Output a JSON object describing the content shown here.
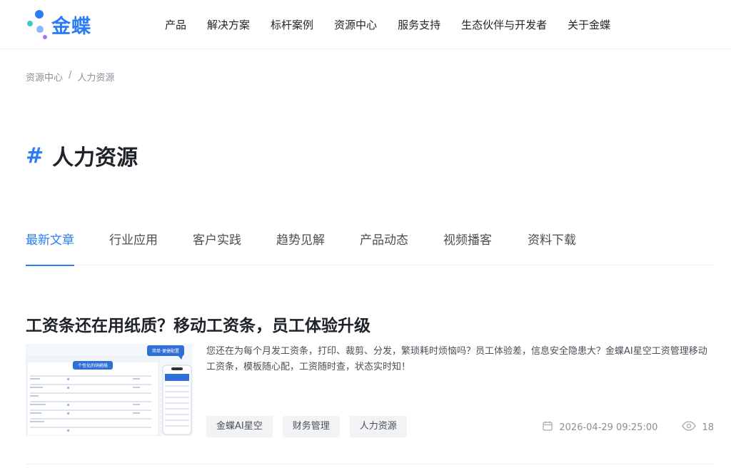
{
  "brand": {
    "name": "金蝶",
    "colors": {
      "primary": "#2a7df5",
      "dot_teal": "#3fc8c2",
      "dot_purple": "#a974f0",
      "dot_blue": "#2a7df5"
    }
  },
  "nav": {
    "items": [
      "产品",
      "解决方案",
      "标杆案例",
      "资源中心",
      "服务支持",
      "生态伙伴与开发者",
      "关于金蝶"
    ]
  },
  "breadcrumb": {
    "items": [
      "资源中心",
      "人力资源"
    ],
    "separator": "/"
  },
  "page": {
    "hash": "#",
    "title": "人力资源"
  },
  "tabs": {
    "items": [
      "最新文章",
      "行业应用",
      "客户实践",
      "趋势见解",
      "产品动态",
      "视频播客",
      "资料下载"
    ],
    "active_index": 0
  },
  "article": {
    "title": "工资条还在用纸质？移动工资条，员工体验升级",
    "summary": "您还在为每个月发工资条，打印、裁剪、分发，繁琐耗时烦恼吗？员工体验差，信息安全隐患大？金蝶AI星空工资管理移动工资条，模板随心配，工资随时查，状态实时知！",
    "tags": [
      "金蝶AI星空",
      "财务管理",
      "人力资源"
    ],
    "date": "2026-04-29 09:25:00",
    "views": "18",
    "thumbnail": {
      "callout_left": "个性化的明细格",
      "callout_right": "简单·便捷配置"
    }
  }
}
